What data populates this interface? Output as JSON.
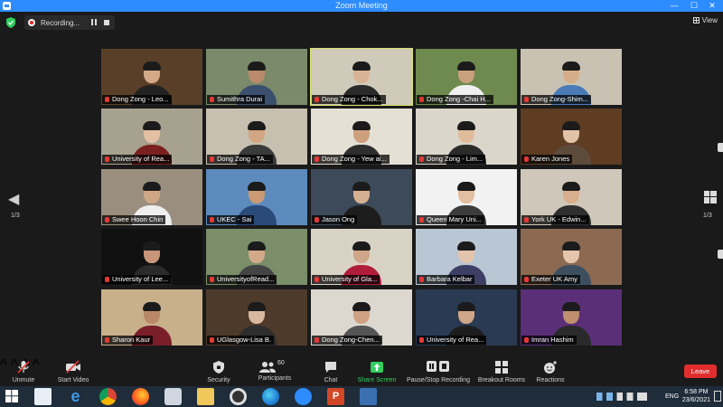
{
  "window": {
    "title": "Zoom Meeting",
    "minimize": "—",
    "maximize": "☐",
    "close": "✕"
  },
  "recording": {
    "label": "Recording..."
  },
  "view": {
    "label": "View"
  },
  "paging": {
    "left": "1/3",
    "right": "1/3"
  },
  "participants": [
    {
      "name": "Dong Zong - Leo...",
      "bg": "#5a3f28",
      "skin": "#d3a987",
      "shirt": "#222"
    },
    {
      "name": "Sumithra Durai",
      "bg": "#7b8a6a",
      "skin": "#b98a6b",
      "shirt": "#3b4f6f"
    },
    {
      "name": "Dong Zong - Chok...",
      "bg": "#cfcab9",
      "skin": "#d9b396",
      "shirt": "#2a2a2a"
    },
    {
      "name": "Dong Zong -Chai H...",
      "bg": "#6e8a4e",
      "skin": "#c9a07c",
      "shirt": "#f0f0f0"
    },
    {
      "name": "Dong Zong-Shim...",
      "bg": "#c9c2b2",
      "skin": "#d6ad8a",
      "shirt": "#4a7bb7"
    },
    {
      "name": "University of Rea...",
      "bg": "#a7a190",
      "skin": "#e4c0a3",
      "shirt": "#7a2020"
    },
    {
      "name": "Dong Zong - TA...",
      "bg": "#c7bfb0",
      "skin": "#d2a682",
      "shirt": "#3a3a3a"
    },
    {
      "name": "Dong Zong - Yew ai...",
      "bg": "#e5e0d4",
      "skin": "#cfa07e",
      "shirt": "#2e2e2e"
    },
    {
      "name": "Dong Zong - Lim...",
      "bg": "#dad6ca",
      "skin": "#e0bc9c",
      "shirt": "#2b2b2b"
    },
    {
      "name": "Karen Jones",
      "bg": "#5e3d23",
      "skin": "#e3c3a8",
      "shirt": "#5c4a3a"
    },
    {
      "name": "Swee Hoon Chin",
      "bg": "#9a8f7e",
      "skin": "#d0a786",
      "shirt": "#eeeeee"
    },
    {
      "name": "UKEC - Sai",
      "bg": "#5d8bbd",
      "skin": "#c99a74",
      "shirt": "#2a4a7a"
    },
    {
      "name": "Jason Ong",
      "bg": "#3d4a59",
      "skin": "#d6b092",
      "shirt": "#1d1d1d"
    },
    {
      "name": "Queen Mary Uni...",
      "bg": "#f2f2f2",
      "skin": "#e2bfa1",
      "shirt": "#3c3c3c"
    },
    {
      "name": "York UK - Edwin...",
      "bg": "#cfc7b9",
      "skin": "#d8ae8c",
      "shirt": "#2f2f2f"
    },
    {
      "name": "University of Lee...",
      "bg": "#111111",
      "skin": "#c8957a",
      "shirt": "#2b2b2b"
    },
    {
      "name": "UniversityofRead...",
      "bg": "#7a8e6a",
      "skin": "#d2aa89",
      "shirt": "#444"
    },
    {
      "name": "University of Gla...",
      "bg": "#d9d3c6",
      "skin": "#cfa689",
      "shirt": "#b01d3a"
    },
    {
      "name": "Barbara Kelbar",
      "bg": "#b9c6d4",
      "skin": "#e3c4ad",
      "shirt": "#3c3f63"
    },
    {
      "name": "Exeter UK Amy",
      "bg": "#8c6a52",
      "skin": "#e6c5ad",
      "shirt": "#3d4f5f"
    },
    {
      "name": "Sharon Kaur",
      "bg": "#c8b08a",
      "skin": "#b98868",
      "shirt": "#7a1f2a"
    },
    {
      "name": "UGlasgow-Lisa B.",
      "bg": "#4e3a2b",
      "skin": "#d9b8a0",
      "shirt": "#2d2d2d"
    },
    {
      "name": "Dong Zong-Chen...",
      "bg": "#dcd8cf",
      "skin": "#cfa283",
      "shirt": "#555"
    },
    {
      "name": "University of Rea...",
      "bg": "#2a3a52",
      "skin": "#cfa688",
      "shirt": "#1d1d1d"
    },
    {
      "name": "Imran Hashim",
      "bg": "#5a2f78",
      "skin": "#bf8f70",
      "shirt": "#2a2a2a"
    }
  ],
  "toolbar": {
    "unmute": "Unmute",
    "start_video": "Start Video",
    "security": "Security",
    "participants": "Participants",
    "participants_count": "60",
    "chat": "Chat",
    "share_screen": "Share Screen",
    "pause_stop": "Pause/Stop Recording",
    "breakout": "Breakout Rooms",
    "reactions": "Reactions",
    "leave": "Leave"
  },
  "taskbar": {
    "lang": "ENG",
    "time": "6:58 PM",
    "date": "23/6/2021"
  },
  "colors": {
    "zoom_blue": "#2d8cff",
    "share_green": "#2fce5e",
    "leave_red": "#e02d2d",
    "active_speaker": "#d8e06a"
  }
}
